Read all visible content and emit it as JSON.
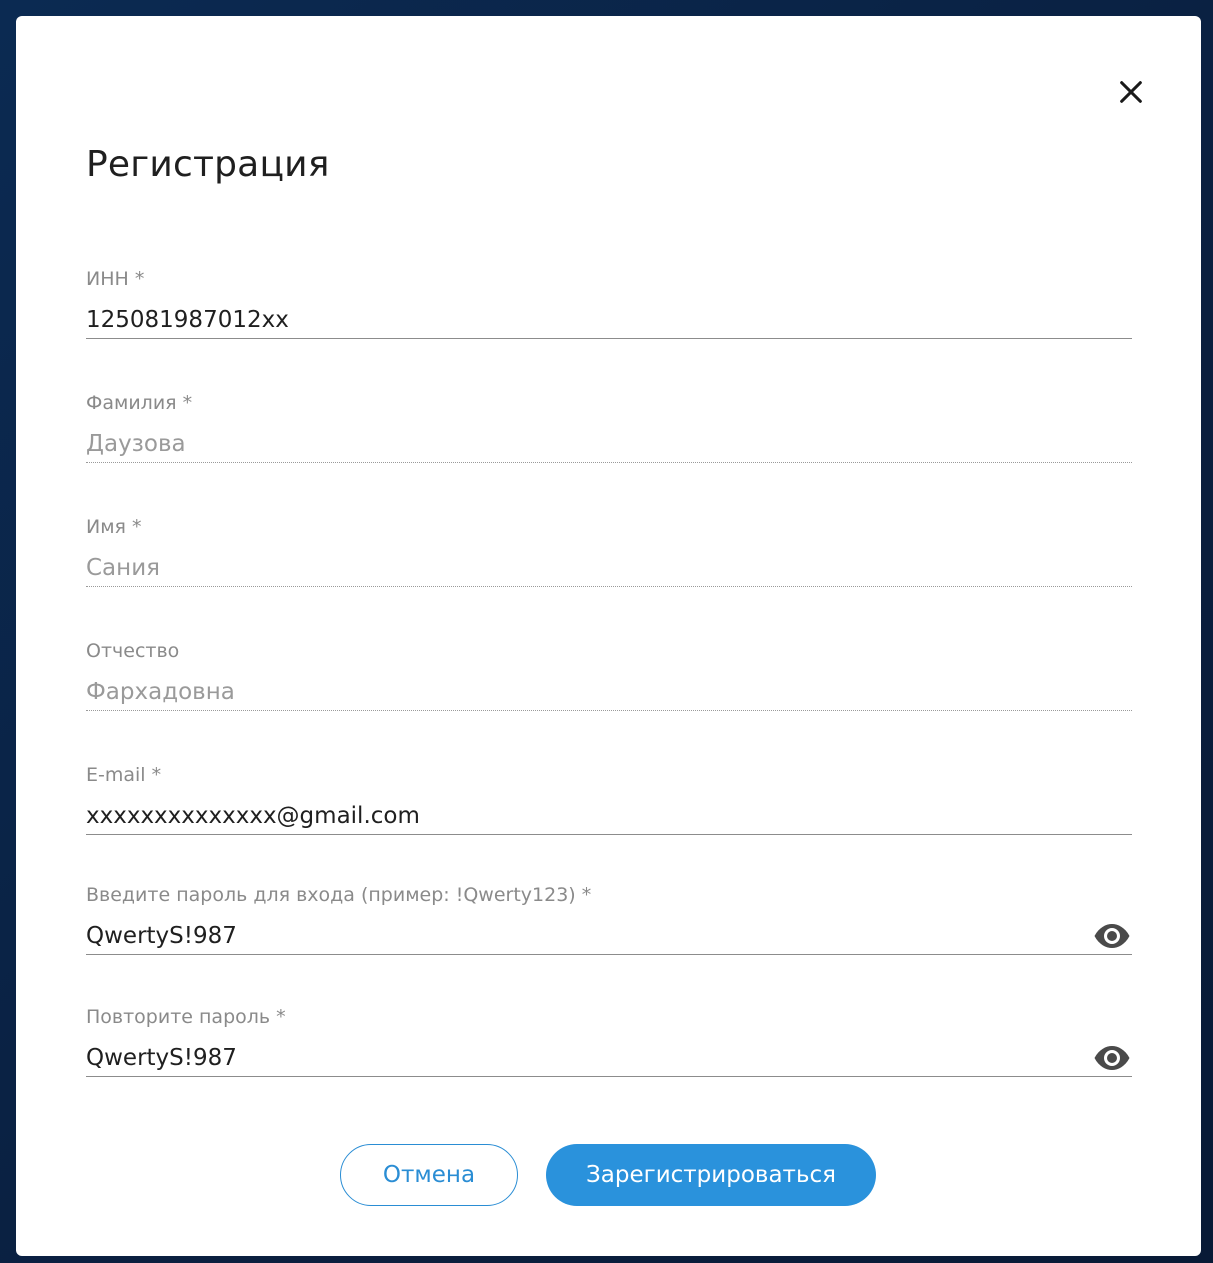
{
  "modal": {
    "title": "Регистрация",
    "close_icon": "close-icon"
  },
  "fields": {
    "inn": {
      "label": "ИНН *",
      "value": "125081987012xx"
    },
    "last_name": {
      "label": "Фамилия *",
      "value": "Даузова"
    },
    "first_name": {
      "label": "Имя *",
      "value": "Сания"
    },
    "patronymic": {
      "label": "Отчество",
      "value": "Фархадовна"
    },
    "email": {
      "label": "E-mail *",
      "value": "xxxxxxxxxxxxxx@gmail.com"
    },
    "password": {
      "label": "Введите пароль для входа (пример: !Qwerty123) *",
      "value": "QwertyS!987",
      "toggle_icon": "eye-icon"
    },
    "password_repeat": {
      "label": "Повторите пароль *",
      "value": "QwertyS!987",
      "toggle_icon": "eye-icon"
    }
  },
  "buttons": {
    "cancel_label": "Отмена",
    "register_label": "Зарегистрироваться"
  },
  "colors": {
    "accent": "#2a92dc",
    "backdrop": "#0b2a52",
    "label": "#8a8a8a",
    "readonly_text": "#9a9a9a"
  }
}
